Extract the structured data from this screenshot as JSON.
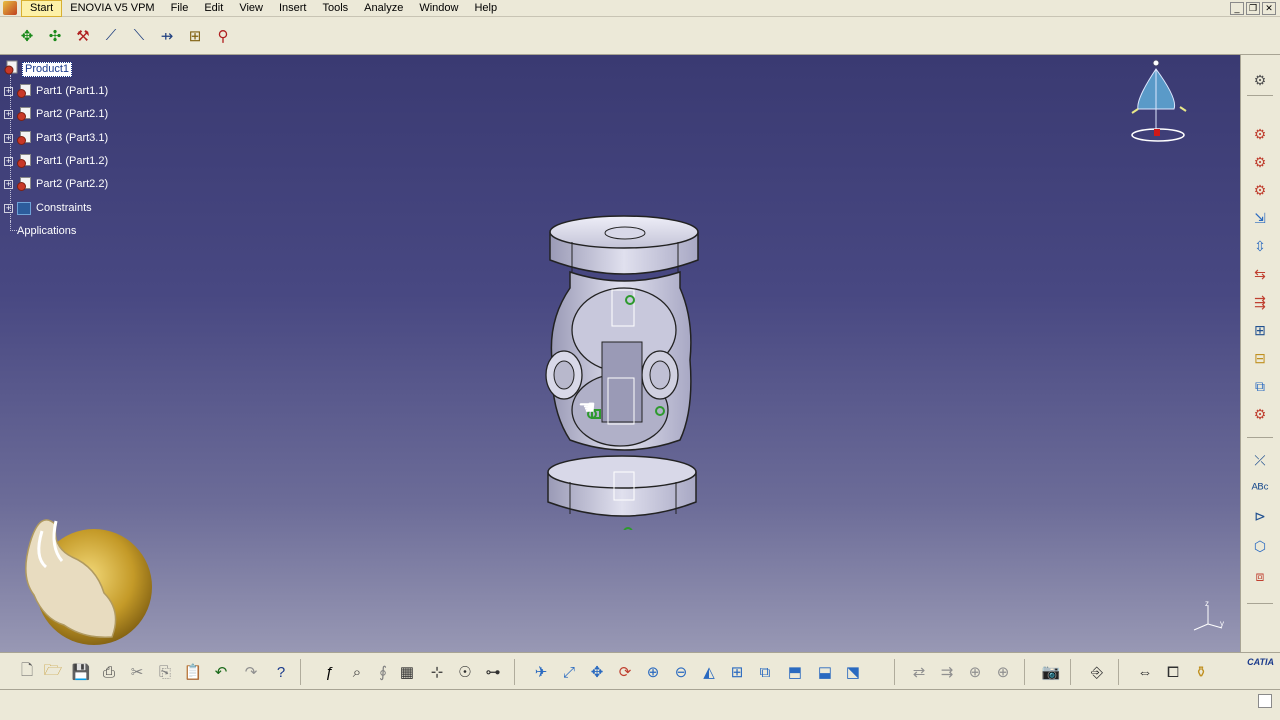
{
  "menubar": {
    "items": [
      "Start",
      "ENOVIA V5 VPM",
      "File",
      "Edit",
      "View",
      "Insert",
      "Tools",
      "Analyze",
      "Window",
      "Help"
    ]
  },
  "tree": {
    "root": "Product1",
    "nodes": [
      {
        "label": "Part1 (Part1.1)"
      },
      {
        "label": "Part2 (Part2.1)"
      },
      {
        "label": "Part3 (Part3.1)"
      },
      {
        "label": "Part1 (Part1.2)"
      },
      {
        "label": "Part2 (Part2.2)"
      }
    ],
    "constraints": "Constraints",
    "applications": "Applications"
  },
  "brand": {
    "catia_logo": "CATIA",
    "axis_z": "z",
    "axis_y": "y"
  },
  "colors": {
    "viewport_top": "#3a3a72",
    "viewport_bottom": "#9898b4",
    "constraint_green": "#2e9a2e",
    "part_gray": "#c8c8dc"
  }
}
